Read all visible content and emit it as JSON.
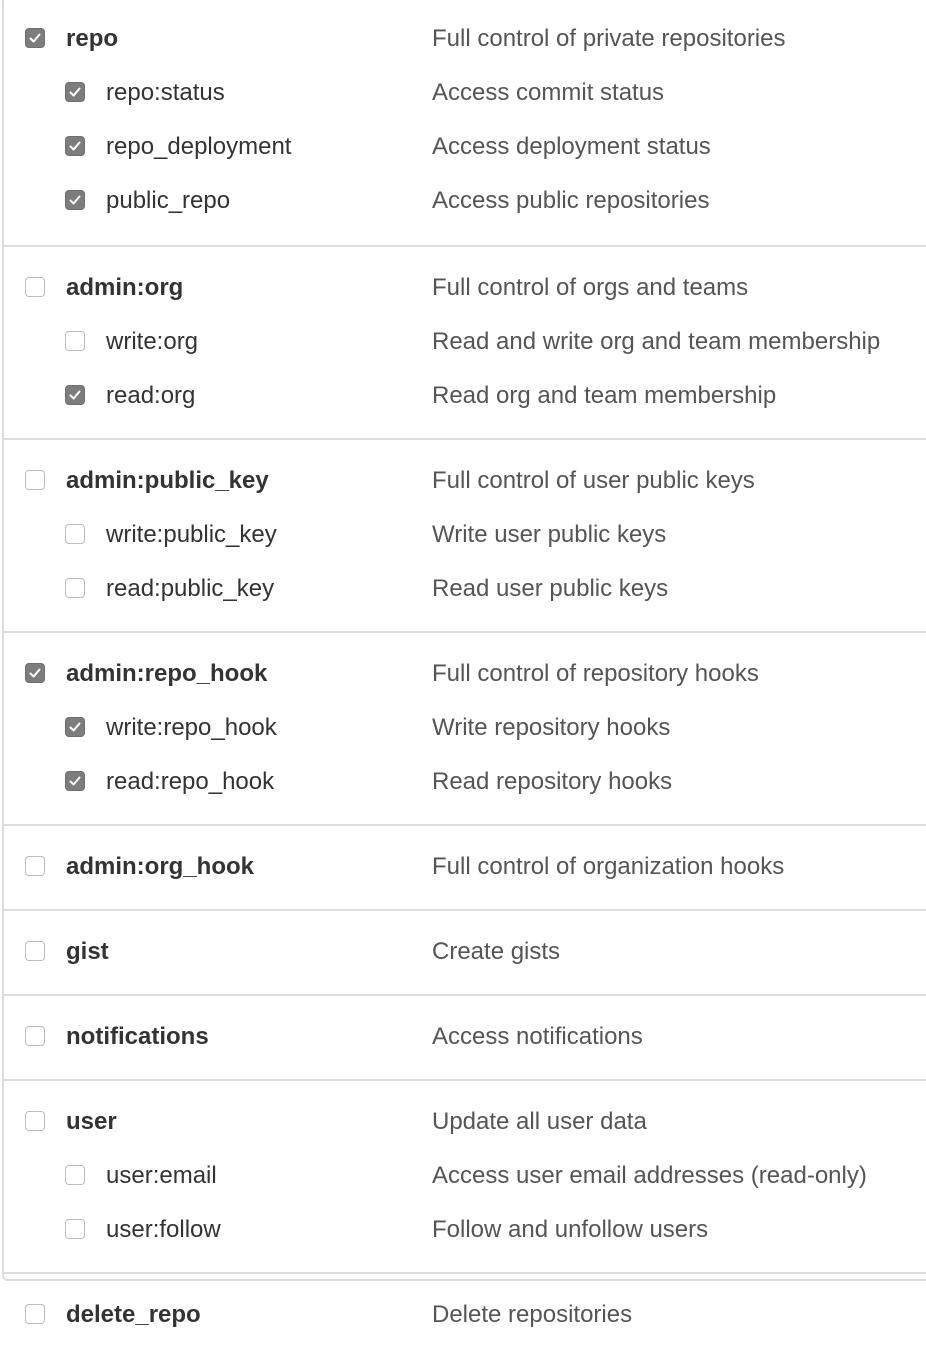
{
  "groups": [
    {
      "scope": {
        "name": "repo",
        "description": "Full control of private repositories",
        "checked": true
      },
      "children": [
        {
          "name": "repo:status",
          "description": "Access commit status",
          "checked": true
        },
        {
          "name": "repo_deployment",
          "description": "Access deployment status",
          "checked": true
        },
        {
          "name": "public_repo",
          "description": "Access public repositories",
          "checked": true
        }
      ]
    },
    {
      "scope": {
        "name": "admin:org",
        "description": "Full control of orgs and teams",
        "checked": false
      },
      "children": [
        {
          "name": "write:org",
          "description": "Read and write org and team membership",
          "checked": false
        },
        {
          "name": "read:org",
          "description": "Read org and team membership",
          "checked": true
        }
      ]
    },
    {
      "scope": {
        "name": "admin:public_key",
        "description": "Full control of user public keys",
        "checked": false
      },
      "children": [
        {
          "name": "write:public_key",
          "description": "Write user public keys",
          "checked": false
        },
        {
          "name": "read:public_key",
          "description": "Read user public keys",
          "checked": false
        }
      ]
    },
    {
      "scope": {
        "name": "admin:repo_hook",
        "description": "Full control of repository hooks",
        "checked": true
      },
      "children": [
        {
          "name": "write:repo_hook",
          "description": "Write repository hooks",
          "checked": true
        },
        {
          "name": "read:repo_hook",
          "description": "Read repository hooks",
          "checked": true
        }
      ]
    },
    {
      "scope": {
        "name": "admin:org_hook",
        "description": "Full control of organization hooks",
        "checked": false
      },
      "children": []
    },
    {
      "scope": {
        "name": "gist",
        "description": "Create gists",
        "checked": false
      },
      "children": []
    },
    {
      "scope": {
        "name": "notifications",
        "description": "Access notifications",
        "checked": false
      },
      "children": []
    },
    {
      "scope": {
        "name": "user",
        "description": "Update all user data",
        "checked": false
      },
      "children": [
        {
          "name": "user:email",
          "description": "Access user email addresses (read-only)",
          "checked": false
        },
        {
          "name": "user:follow",
          "description": "Follow and unfollow users",
          "checked": false
        }
      ]
    },
    {
      "scope": {
        "name": "delete_repo",
        "description": "Delete repositories",
        "checked": false
      },
      "children": []
    }
  ],
  "icons": {
    "checkbox_checked": "checkmark-icon"
  },
  "colors": {
    "checked_fill": "#7d7d7d",
    "border": "#dddddd",
    "text": "#333333"
  }
}
